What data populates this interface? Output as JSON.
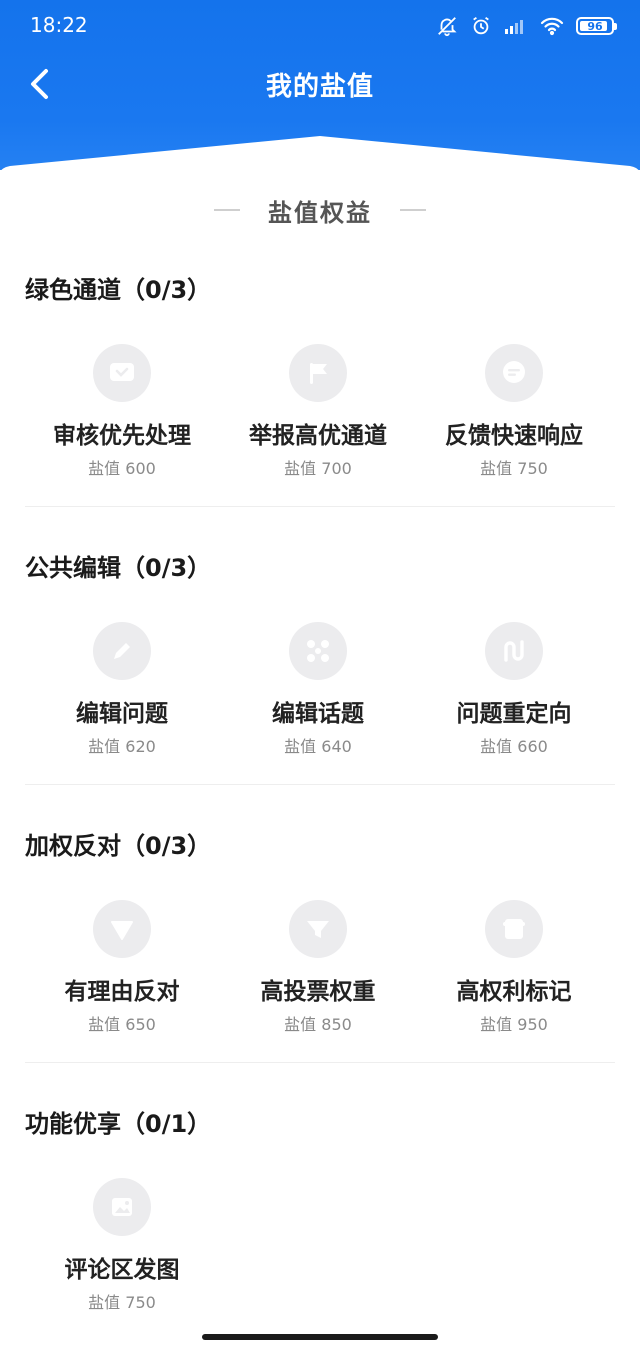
{
  "status_bar": {
    "time": "18:22",
    "battery": "96"
  },
  "header": {
    "title": "我的盐值"
  },
  "section_heading": "盐值权益",
  "groups": [
    {
      "title": "绿色通道（0/3）",
      "items": [
        {
          "label": "审核优先处理",
          "value": "盐值 600",
          "icon": "chat-icon"
        },
        {
          "label": "举报高优通道",
          "value": "盐值 700",
          "icon": "flag-icon"
        },
        {
          "label": "反馈快速响应",
          "value": "盐值 750",
          "icon": "message-icon"
        }
      ]
    },
    {
      "title": "公共编辑（0/3）",
      "items": [
        {
          "label": "编辑问题",
          "value": "盐值 620",
          "icon": "pencil-icon"
        },
        {
          "label": "编辑话题",
          "value": "盐值 640",
          "icon": "nodes-icon"
        },
        {
          "label": "问题重定向",
          "value": "盐值 660",
          "icon": "redirect-icon"
        }
      ]
    },
    {
      "title": "加权反对（0/3）",
      "items": [
        {
          "label": "有理由反对",
          "value": "盐值 650",
          "icon": "triangle-down-icon"
        },
        {
          "label": "高投票权重",
          "value": "盐值 850",
          "icon": "funnel-icon"
        },
        {
          "label": "高权利标记",
          "value": "盐值 950",
          "icon": "card-icon"
        }
      ]
    },
    {
      "title": "功能优享（0/1）",
      "items": [
        {
          "label": "评论区发图",
          "value": "盐值 750",
          "icon": "image-icon"
        }
      ]
    }
  ],
  "colors": {
    "header_blue": "#1473ec",
    "icon_bg": "#ececee",
    "value_gray": "#8a8a8a"
  }
}
